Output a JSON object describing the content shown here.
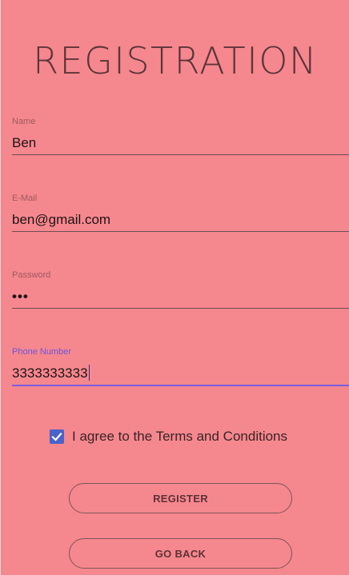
{
  "title": "REGISTRATION",
  "fields": {
    "name": {
      "label": "Name",
      "value": "Ben"
    },
    "email": {
      "label": "E-Mail",
      "value": "ben@gmail.com"
    },
    "password": {
      "label": "Password",
      "value": "•••"
    },
    "phone": {
      "label": "Phone Number",
      "value": "3333333333"
    }
  },
  "terms": {
    "label": "I agree to the Terms and Conditions",
    "checked": true
  },
  "buttons": {
    "register": "REGISTER",
    "go_back": "GO BACK"
  },
  "colors": {
    "background": "#f5878e",
    "accent": "#7a5be0",
    "checkbox": "#4b63c9"
  },
  "icons": {
    "checkbox": "check-icon"
  }
}
